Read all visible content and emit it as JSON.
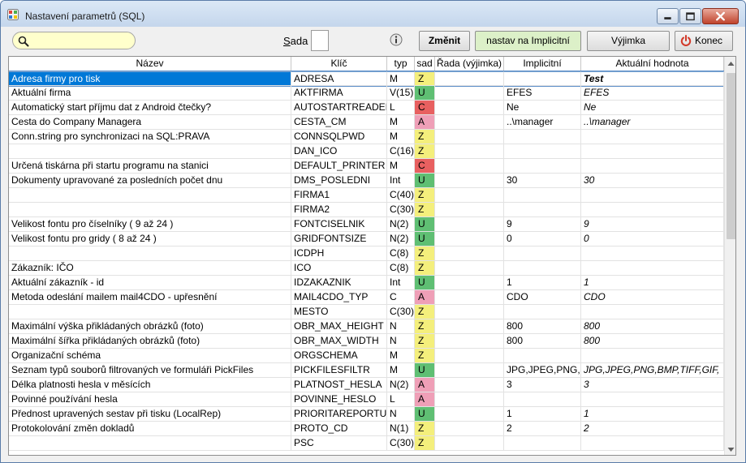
{
  "window": {
    "title": "Nastavení parametrů (SQL)"
  },
  "toolbar": {
    "search_placeholder": "",
    "sada_label_u": "S",
    "sada_label_rest": "ada",
    "zmenit_label": "Změnit",
    "nastav_label": "nastav na Implicitní",
    "vyjimka_label": "Výjimka",
    "konec_label": "Konec"
  },
  "grid": {
    "columns": [
      "Název",
      "Klíč",
      "typ",
      "sad",
      "Řada (výjimka)",
      "Implicitní",
      "Aktuální hodnota"
    ],
    "rows": [
      {
        "nazev": "Adresa firmy pro tisk",
        "klic": "ADRESA",
        "typ": "M",
        "sad": "Z",
        "rada": "",
        "impl": "",
        "akt": "Test",
        "selected": true
      },
      {
        "nazev": "Aktuální firma",
        "klic": "AKTFIRMA",
        "typ": "V(15)",
        "sad": "U",
        "rada": "",
        "impl": "EFES",
        "akt": "EFES"
      },
      {
        "nazev": "Automatický start příjmu dat z Android čtečky?",
        "klic": "AUTOSTARTREADER",
        "typ": "L",
        "sad": "C",
        "rada": "",
        "impl": "Ne",
        "akt": "Ne"
      },
      {
        "nazev": "Cesta do Company Managera",
        "klic": "CESTA_CM",
        "typ": "M",
        "sad": "A",
        "rada": "",
        "impl": "..\\manager",
        "akt": "..\\manager"
      },
      {
        "nazev": "Conn.string pro synchronizaci na SQL:PRAVA",
        "klic": "CONNSQLPWD",
        "typ": "M",
        "sad": "Z",
        "rada": "",
        "impl": "",
        "akt": ""
      },
      {
        "nazev": "",
        "klic": "DAN_ICO",
        "typ": "C(16)",
        "sad": "Z",
        "rada": "",
        "impl": "",
        "akt": ""
      },
      {
        "nazev": "Určená tiskárna při startu programu na stanici",
        "klic": "DEFAULT_PRINTER",
        "typ": "M",
        "sad": "C",
        "rada": "",
        "impl": "",
        "akt": ""
      },
      {
        "nazev": "Dokumenty upravované za posledních počet dnu",
        "klic": "DMS_POSLEDNI",
        "typ": "Int",
        "sad": "U",
        "rada": "",
        "impl": "30",
        "akt": "30"
      },
      {
        "nazev": "",
        "klic": "FIRMA1",
        "typ": "C(40)",
        "sad": "Z",
        "rada": "",
        "impl": "",
        "akt": ""
      },
      {
        "nazev": "",
        "klic": "FIRMA2",
        "typ": "C(30)",
        "sad": "Z",
        "rada": "",
        "impl": "",
        "akt": ""
      },
      {
        "nazev": "Velikost fontu pro číselníky ( 9 až 24 )",
        "klic": "FONTCISELNIK",
        "typ": "N(2)",
        "sad": "U",
        "rada": "",
        "impl": "9",
        "akt": "9"
      },
      {
        "nazev": "Velikost fontu pro gridy ( 8 až 24 )",
        "klic": "GRIDFONTSIZE",
        "typ": "N(2)",
        "sad": "U",
        "rada": "",
        "impl": "0",
        "akt": "0"
      },
      {
        "nazev": "",
        "klic": "ICDPH",
        "typ": "C(8)",
        "sad": "Z",
        "rada": "",
        "impl": "",
        "akt": ""
      },
      {
        "nazev": "Zákazník: IČO",
        "klic": "ICO",
        "typ": "C(8)",
        "sad": "Z",
        "rada": "",
        "impl": "",
        "akt": ""
      },
      {
        "nazev": "Aktuální zákazník - id",
        "klic": "IDZAKAZNIK",
        "typ": "Int",
        "sad": "U",
        "rada": "",
        "impl": "1",
        "akt": "1"
      },
      {
        "nazev": "Metoda odeslání mailem mail4CDO - upřesnění",
        "klic": "MAIL4CDO_TYP",
        "typ": "C",
        "sad": "A",
        "rada": "",
        "impl": "CDO",
        "akt": "CDO"
      },
      {
        "nazev": "",
        "klic": "MESTO",
        "typ": "C(30)",
        "sad": "Z",
        "rada": "",
        "impl": "",
        "akt": ""
      },
      {
        "nazev": "Maximální výška přikládaných obrázků (foto)",
        "klic": "OBR_MAX_HEIGHT",
        "typ": "N",
        "sad": "Z",
        "rada": "",
        "impl": "800",
        "akt": "800"
      },
      {
        "nazev": "Maximální šířka přikládaných obrázků (foto)",
        "klic": "OBR_MAX_WIDTH",
        "typ": "N",
        "sad": "Z",
        "rada": "",
        "impl": "800",
        "akt": "800"
      },
      {
        "nazev": "Organizační schéma",
        "klic": "ORGSCHEMA",
        "typ": "M",
        "sad": "Z",
        "rada": "",
        "impl": "",
        "akt": ""
      },
      {
        "nazev": "Seznam typů souborů filtrovaných ve formuláři PickFiles",
        "klic": "PICKFILESFILTR",
        "typ": "M",
        "sad": "U",
        "rada": "",
        "impl": "JPG,JPEG,PNG,I",
        "akt": "JPG,JPEG,PNG,BMP,TIFF,GIF,"
      },
      {
        "nazev": "Délka platnosti hesla v měsících",
        "klic": "PLATNOST_HESLA",
        "typ": "N(2)",
        "sad": "A",
        "rada": "",
        "impl": "3",
        "akt": "3"
      },
      {
        "nazev": "Povinné používání hesla",
        "klic": "POVINNE_HESLO",
        "typ": "L",
        "sad": "A",
        "rada": "",
        "impl": "",
        "akt": ""
      },
      {
        "nazev": "Přednost upravených sestav při tisku (LocalRep)",
        "klic": "PRIORITAREPORTU",
        "typ": "N",
        "sad": "U",
        "rada": "",
        "impl": "1",
        "akt": "1"
      },
      {
        "nazev": "Protokolování změn dokladů",
        "klic": "PROTO_CD",
        "typ": "N(1)",
        "sad": "Z",
        "rada": "",
        "impl": "2",
        "akt": "2"
      },
      {
        "nazev": "",
        "klic": "PSC",
        "typ": "C(30)",
        "sad": "Z",
        "rada": "",
        "impl": "",
        "akt": ""
      }
    ]
  },
  "colors": {
    "U": "#5fbf73",
    "Z": "#f4ef7c",
    "C": "#e86060",
    "A": "#ef9fb7"
  }
}
